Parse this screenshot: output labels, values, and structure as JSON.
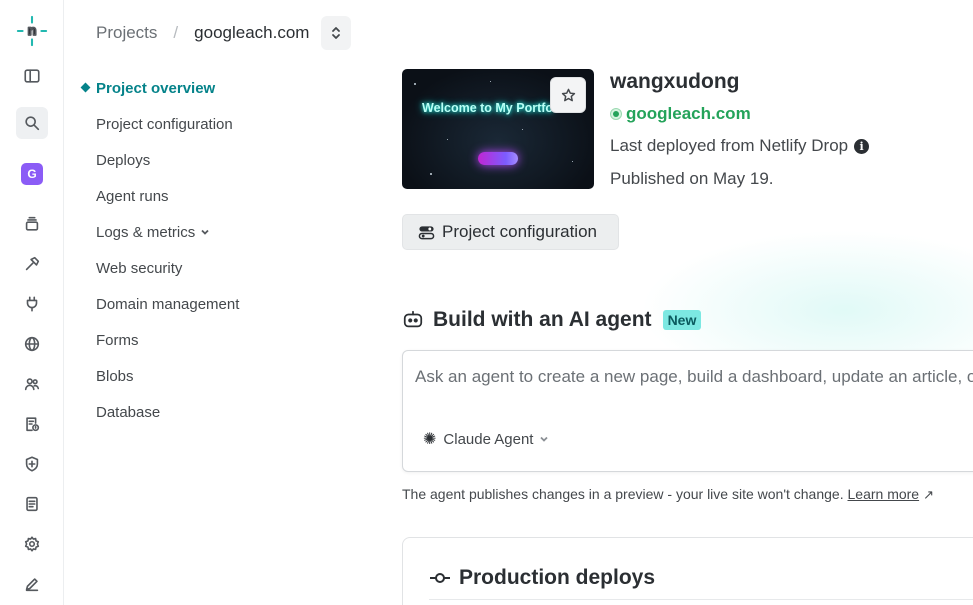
{
  "rail": {
    "logo_letter": "n",
    "team_initial": "G"
  },
  "breadcrumb": {
    "projects": "Projects",
    "separator": "/",
    "site": "googleach.com"
  },
  "subnav": {
    "items": [
      {
        "label": "Project overview"
      },
      {
        "label": "Project configuration"
      },
      {
        "label": "Deploys"
      },
      {
        "label": "Agent runs"
      },
      {
        "label": "Logs & metrics"
      },
      {
        "label": "Web security"
      },
      {
        "label": "Domain management"
      },
      {
        "label": "Forms"
      },
      {
        "label": "Blobs"
      },
      {
        "label": "Database"
      }
    ]
  },
  "project": {
    "thumbnail_text": "Welcome to My Portfo",
    "name": "wangxudong",
    "url": "googleach.com",
    "deploy_source": "Last deployed from Netlify Drop",
    "info_glyph": "i",
    "published": "Published on May 19.",
    "config_button": "Project configuration"
  },
  "ai_agent": {
    "heading": "Build with an AI agent",
    "badge": "New",
    "placeholder": "Ask an agent to create a new page, build a dashboard, update an article, or make any change",
    "agent_name": "Claude Agent",
    "note": "The agent publishes changes in a preview - your live site won't change.",
    "learn_more": "Learn more",
    "learn_more_arrow": "↗"
  },
  "deploys": {
    "heading": "Production deploys"
  },
  "colors": {
    "accent_teal": "#05838a",
    "live_green": "#24a35a",
    "new_badge": "#7ce8e2",
    "team_badge": "#8b5cf6"
  }
}
